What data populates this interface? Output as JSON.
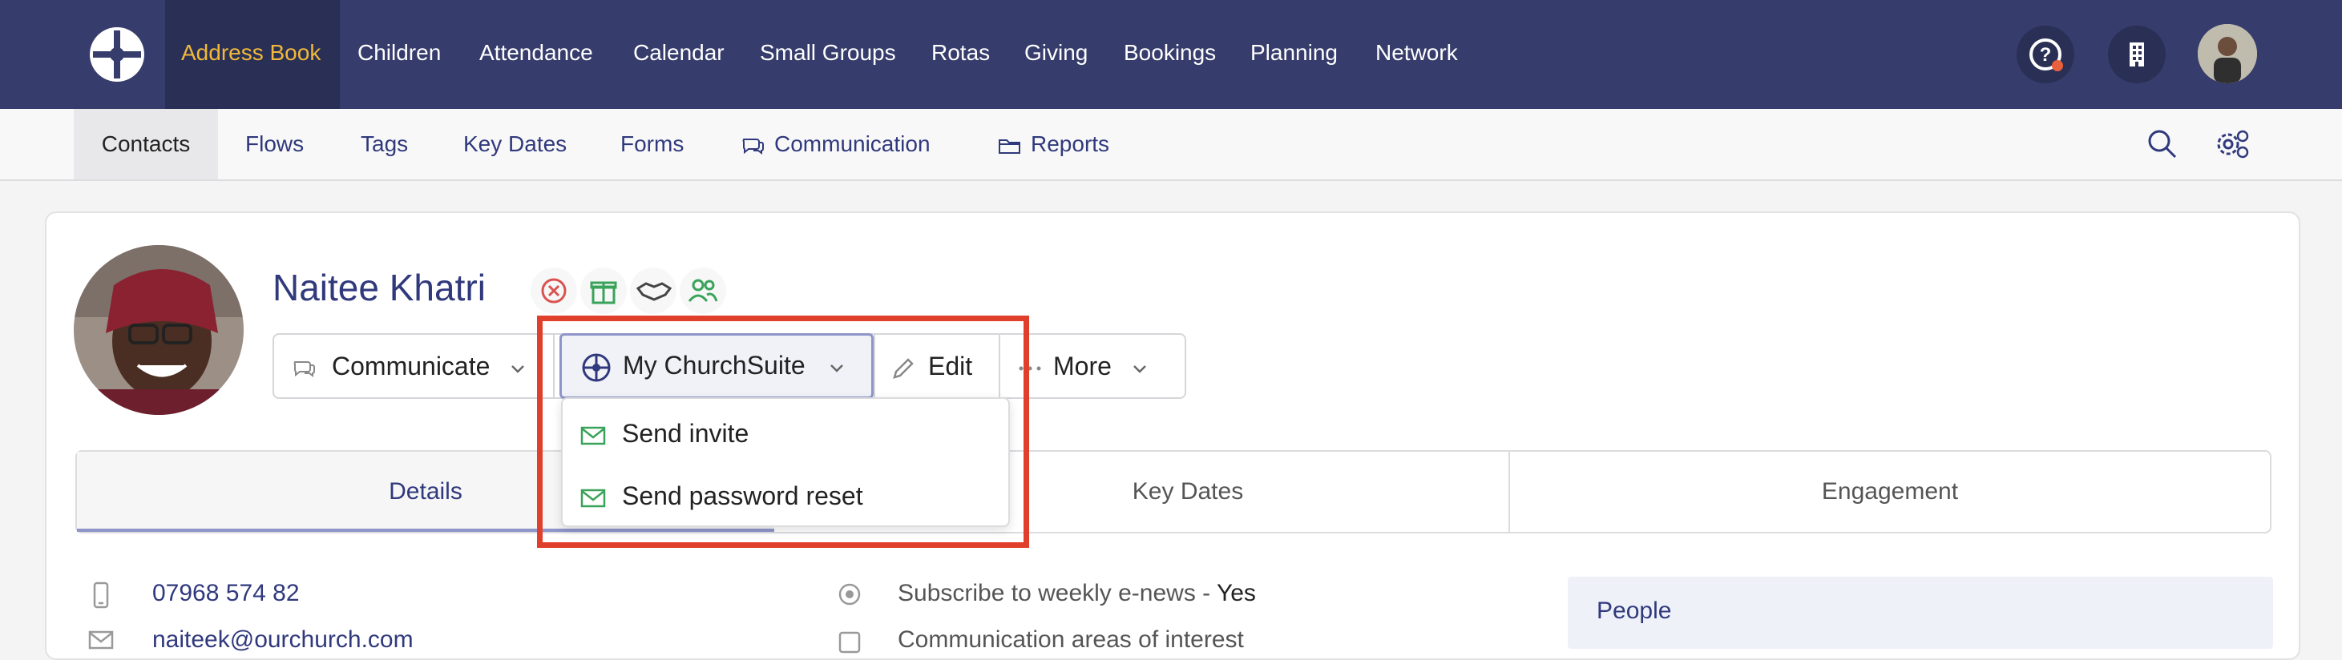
{
  "topnav": {
    "items": [
      {
        "label": "Address Book",
        "active": true
      },
      {
        "label": "Children"
      },
      {
        "label": "Attendance"
      },
      {
        "label": "Calendar"
      },
      {
        "label": "Small Groups"
      },
      {
        "label": "Rotas"
      },
      {
        "label": "Giving"
      },
      {
        "label": "Bookings"
      },
      {
        "label": "Planning"
      },
      {
        "label": "Network"
      }
    ],
    "icons": [
      "help-icon",
      "building-icon",
      "user-avatar"
    ]
  },
  "subnav": {
    "items": [
      {
        "label": "Contacts",
        "active": true
      },
      {
        "label": "Flows"
      },
      {
        "label": "Tags"
      },
      {
        "label": "Key Dates"
      },
      {
        "label": "Forms"
      },
      {
        "label": "Communication",
        "icon": "chat-icon"
      },
      {
        "label": "Reports",
        "icon": "folder-icon"
      }
    ]
  },
  "contact": {
    "name": "Naitee Khatri",
    "phone": "07968 574 82",
    "email": "naiteek@ourchurch.com"
  },
  "actions": {
    "communicate": "Communicate",
    "my_churchsuite": "My ChurchSuite",
    "edit": "Edit",
    "more": "More"
  },
  "dropdown": {
    "items": [
      "Send invite",
      "Send password reset"
    ]
  },
  "tabs": [
    "Details",
    "Key Dates",
    "Engagement"
  ],
  "fields": {
    "subscribe_label": "Subscribe to weekly e-news - ",
    "subscribe_value": "Yes",
    "comm_areas": "Communication areas of interest"
  },
  "people_panel": {
    "title": "People"
  },
  "colors": {
    "nav_bg": "#363c6b",
    "accent": "#f0b93b",
    "link": "#30397c",
    "highlight": "#e0402b",
    "green": "#3aa35a",
    "red": "#d9534f"
  }
}
